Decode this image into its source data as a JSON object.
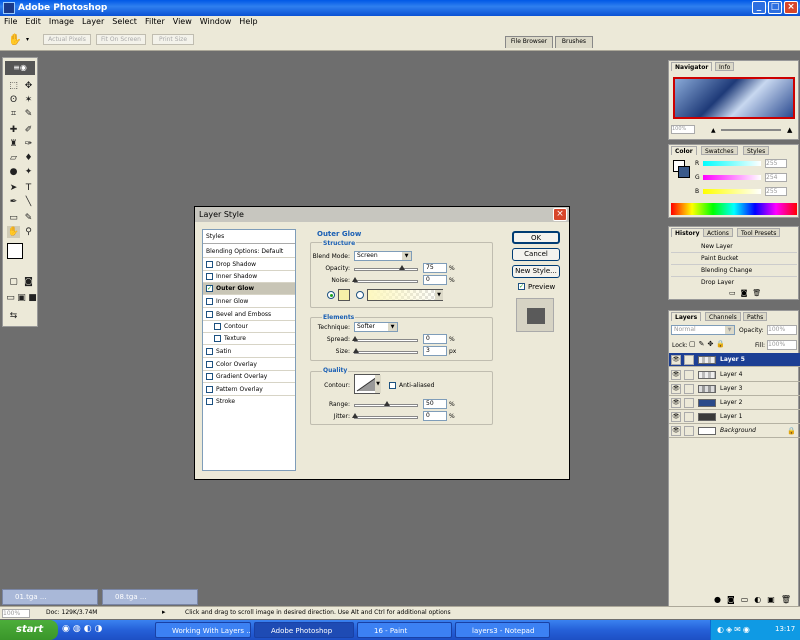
{
  "app": {
    "title": "Adobe Photoshop"
  },
  "menu": [
    "File",
    "Edit",
    "Image",
    "Layer",
    "Select",
    "Filter",
    "View",
    "Window",
    "Help"
  ],
  "options_bar": {
    "actual_pixels": "Actual Pixels",
    "fit_on_screen": "Fit On Screen",
    "print_size": "Print Size",
    "file_browser": "File Browser",
    "brushes": "Brushes"
  },
  "navigator": {
    "tabs": [
      "Navigator",
      "Info"
    ],
    "zoom": "100%"
  },
  "color_panel": {
    "tabs": [
      "Color",
      "Swatches",
      "Styles"
    ],
    "r_label": "R",
    "g_label": "G",
    "b_label": "B",
    "r": "255",
    "g": "254",
    "b": "255"
  },
  "history": {
    "tabs": [
      "History",
      "Actions",
      "Tool Presets"
    ],
    "items": [
      "New Layer",
      "Paint Bucket",
      "Blending Change",
      "Drop Layer"
    ]
  },
  "layers_panel": {
    "tabs": [
      "Layers",
      "Channels",
      "Paths"
    ],
    "blend_mode": "Normal",
    "opacity_label": "Opacity:",
    "opacity": "100%",
    "lock_label": "Lock:",
    "fill_label": "Fill:",
    "fill": "100%",
    "layers": [
      {
        "name": "Layer 5",
        "selected": true
      },
      {
        "name": "Layer 4",
        "selected": false
      },
      {
        "name": "Layer 3",
        "selected": false
      },
      {
        "name": "Layer 2",
        "selected": false
      },
      {
        "name": "Layer 1",
        "selected": false
      },
      {
        "name": "Background",
        "selected": false
      }
    ]
  },
  "dialog": {
    "title": "Layer Style",
    "styles_header": "Styles",
    "blending_options": "Blending Options: Default",
    "style_items": [
      "Drop Shadow",
      "Inner Shadow",
      "Outer Glow",
      "Inner Glow",
      "Bevel and Emboss",
      "Contour",
      "Texture",
      "Satin",
      "Color Overlay",
      "Gradient Overlay",
      "Pattern Overlay",
      "Stroke"
    ],
    "section_title": "Outer Glow",
    "structure": {
      "title": "Structure",
      "blend_mode_label": "Blend Mode:",
      "blend_mode": "Screen",
      "opacity_label": "Opacity:",
      "opacity": "75",
      "opacity_unit": "%",
      "noise_label": "Noise:",
      "noise": "0",
      "noise_unit": "%",
      "opacity_level": 0.75,
      "noise_level": 0
    },
    "elements": {
      "title": "Elements",
      "technique_label": "Technique:",
      "technique": "Softer",
      "spread_label": "Spread:",
      "spread": "0",
      "spread_unit": "%",
      "size_label": "Size:",
      "size": "3",
      "size_unit": "px"
    },
    "quality": {
      "title": "Quality",
      "contour_label": "Contour:",
      "anti_aliased": "Anti-aliased",
      "range_label": "Range:",
      "range": "50",
      "range_unit": "%",
      "jitter_label": "Jitter:",
      "jitter": "0",
      "jitter_unit": "%"
    },
    "buttons": {
      "ok": "OK",
      "cancel": "Cancel",
      "new_style": "New Style...",
      "preview": "Preview"
    },
    "glow_color": "#f6f0a8"
  },
  "minimized_docs": [
    "01.tga ...",
    "08.tga ..."
  ],
  "status": {
    "zoom": "100%",
    "doc": "Doc: 129K/3.74M",
    "hint": "Click and drag to scroll image in desired direction.  Use Alt and Ctrl for additional options"
  },
  "taskbar": {
    "start": "start",
    "tasks": [
      "Working With Layers ...",
      "Adobe Photoshop",
      "16 - Paint",
      "layers3 - Notepad"
    ],
    "clock": "13:17"
  }
}
